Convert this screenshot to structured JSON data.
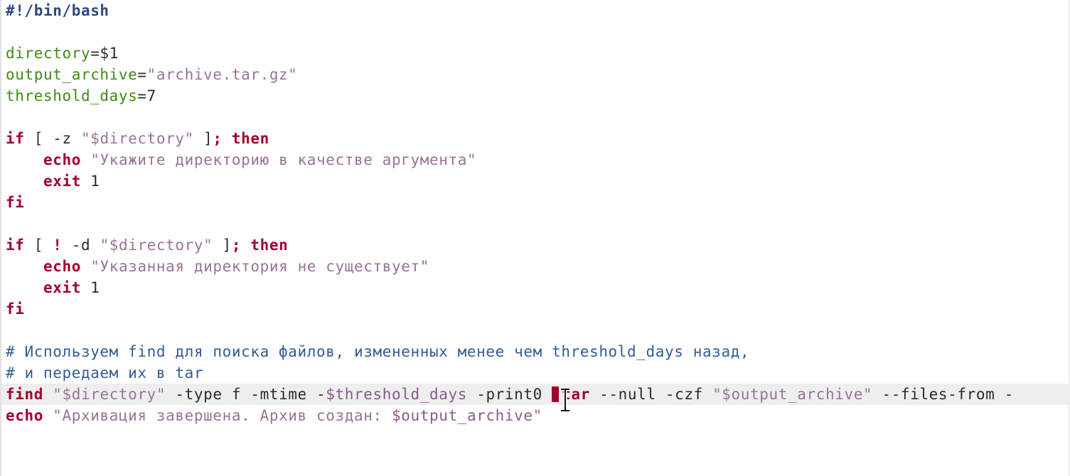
{
  "editor": {
    "lines": [
      [
        {
          "cls": "t-shebang",
          "text": "#!/bin/bash"
        }
      ],
      [],
      [
        {
          "cls": "t-variable",
          "text": "directory"
        },
        {
          "cls": "t-default",
          "text": "=$1"
        }
      ],
      [
        {
          "cls": "t-variable",
          "text": "output_archive"
        },
        {
          "cls": "t-default",
          "text": "="
        },
        {
          "cls": "t-string",
          "text": "\"archive.tar.gz\""
        }
      ],
      [
        {
          "cls": "t-variable",
          "text": "threshold_days"
        },
        {
          "cls": "t-default",
          "text": "=7"
        }
      ],
      [],
      [
        {
          "cls": "t-keyword",
          "text": "if"
        },
        {
          "cls": "t-default",
          "text": " [ -z "
        },
        {
          "cls": "t-string",
          "text": "\"$directory\""
        },
        {
          "cls": "t-default",
          "text": " ]"
        },
        {
          "cls": "t-punct",
          "text": ";"
        },
        {
          "cls": "t-default",
          "text": " "
        },
        {
          "cls": "t-keyword",
          "text": "then"
        }
      ],
      [
        {
          "cls": "t-default",
          "text": "    "
        },
        {
          "cls": "t-keyword",
          "text": "echo"
        },
        {
          "cls": "t-default",
          "text": " "
        },
        {
          "cls": "t-string",
          "text": "\"Укажите директорию в качестве аргумента\""
        }
      ],
      [
        {
          "cls": "t-default",
          "text": "    "
        },
        {
          "cls": "t-keyword",
          "text": "exit"
        },
        {
          "cls": "t-default",
          "text": " 1"
        }
      ],
      [
        {
          "cls": "t-keyword",
          "text": "fi"
        }
      ],
      [],
      [
        {
          "cls": "t-keyword",
          "text": "if"
        },
        {
          "cls": "t-default",
          "text": " [ "
        },
        {
          "cls": "t-punct",
          "text": "!"
        },
        {
          "cls": "t-default",
          "text": " -d "
        },
        {
          "cls": "t-string",
          "text": "\"$directory\""
        },
        {
          "cls": "t-default",
          "text": " ]"
        },
        {
          "cls": "t-punct",
          "text": ";"
        },
        {
          "cls": "t-default",
          "text": " "
        },
        {
          "cls": "t-keyword",
          "text": "then"
        }
      ],
      [
        {
          "cls": "t-default",
          "text": "    "
        },
        {
          "cls": "t-keyword",
          "text": "echo"
        },
        {
          "cls": "t-default",
          "text": " "
        },
        {
          "cls": "t-string",
          "text": "\"Указанная директория не существует\""
        }
      ],
      [
        {
          "cls": "t-default",
          "text": "    "
        },
        {
          "cls": "t-keyword",
          "text": "exit"
        },
        {
          "cls": "t-default",
          "text": " 1"
        }
      ],
      [
        {
          "cls": "t-keyword",
          "text": "fi"
        }
      ],
      [],
      [
        {
          "cls": "t-comment",
          "text": "# Используем find для поиска файлов, измененных менее чем threshold_days назад,"
        }
      ],
      [
        {
          "cls": "t-comment",
          "text": "# и передаем их в tar"
        }
      ],
      [
        {
          "cls": "t-keyword",
          "text": "find"
        },
        {
          "cls": "t-default",
          "text": " "
        },
        {
          "cls": "t-string",
          "text": "\"$directory\""
        },
        {
          "cls": "t-default",
          "text": " -type f -mtime -"
        },
        {
          "cls": "t-expansion",
          "text": "$threshold_days"
        },
        {
          "cls": "t-default",
          "text": " -print0 "
        },
        {
          "cls": "t-cursor",
          "text": ""
        },
        {
          "cls": "t-keyword",
          "text": "tar"
        },
        {
          "cls": "t-default",
          "text": " --null -czf "
        },
        {
          "cls": "t-string",
          "text": "\"$output_archive\""
        },
        {
          "cls": "t-default",
          "text": " --files-from -"
        }
      ],
      [
        {
          "cls": "t-keyword",
          "text": "echo"
        },
        {
          "cls": "t-default",
          "text": " "
        },
        {
          "cls": "t-string",
          "text": "\"Архивация завершена. Архив создан: "
        },
        {
          "cls": "t-expansion",
          "text": "$output_archive"
        },
        {
          "cls": "t-string",
          "text": "\""
        }
      ]
    ],
    "current_line_index": 18
  },
  "icons": {
    "text_cursor": "ibeam-cursor-icon"
  }
}
